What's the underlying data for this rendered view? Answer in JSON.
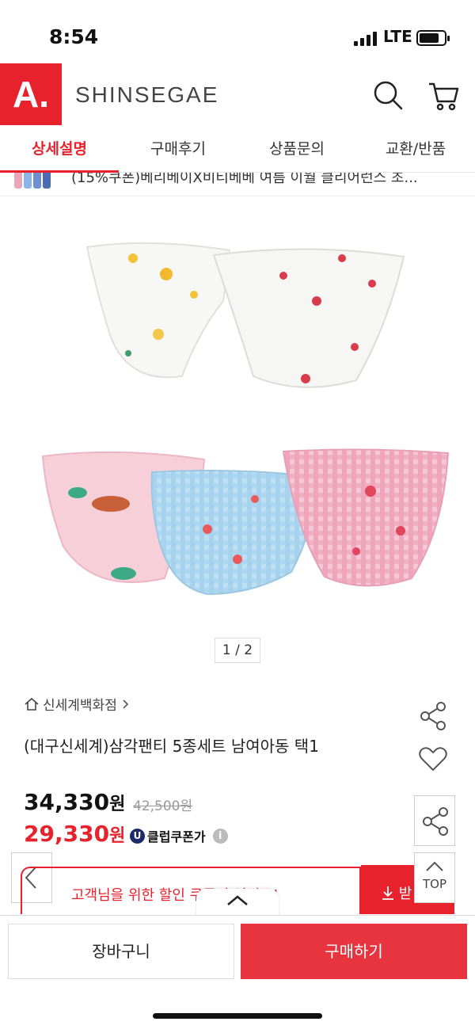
{
  "status_bar": {
    "time": "8:54",
    "network": "LTE"
  },
  "header": {
    "logo": "A.",
    "brand": "SHINSEGAE"
  },
  "tabs": [
    {
      "label": "상세설명",
      "active": true
    },
    {
      "label": "구매후기",
      "active": false
    },
    {
      "label": "상품문의",
      "active": false
    },
    {
      "label": "교환/반품",
      "active": false
    }
  ],
  "banner": {
    "text": "(15%쿠폰)베리베이X비티베베 여름 이월 클리어런스 초..."
  },
  "gallery": {
    "pager": "1 / 2"
  },
  "product": {
    "store": "신세계백화점",
    "title": "(대구신세계)삼각팬티 5종세트 남여아동 택1",
    "price": "34,330",
    "price_unit": "원",
    "original_price": "42,500원",
    "club_price": "29,330",
    "club_label": "클럽쿠폰가"
  },
  "coupon": {
    "text": "고객님을 위한 할인 쿠폰이 있어요!",
    "button_label": "받"
  },
  "floating": {
    "top_label": "TOP"
  },
  "bottom_bar": {
    "cart": "장바구니",
    "buy": "구매하기"
  },
  "colors": {
    "accent": "#e8222d",
    "buy": "#e8343f"
  }
}
